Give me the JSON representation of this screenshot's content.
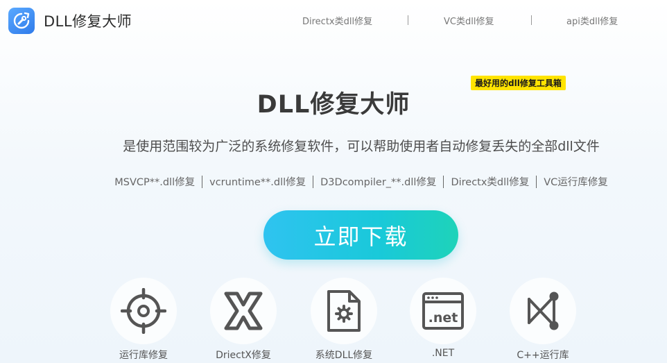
{
  "header": {
    "brand": "DLL修复大师",
    "nav": [
      {
        "label": "Directx类dll修复"
      },
      {
        "label": "VC类dll修复"
      },
      {
        "label": "api类dll修复"
      }
    ]
  },
  "hero": {
    "title": "DLL修复大师",
    "badge": "最好用的dll修复工具箱",
    "subtitle": "是使用范围较为广泛的系统修复软件，可以帮助使用者自动修复丢失的全部dll文件",
    "tags": [
      "MSVCP**.dll修复",
      "vcruntime**.dll修复",
      "D3Dcompiler_**.dll修复",
      "Directx类dll修复",
      "VC运行库修复"
    ],
    "download_label": "立即下载"
  },
  "features": [
    {
      "label": "运行库修复",
      "icon": "target-icon"
    },
    {
      "label": "DriectX修复",
      "icon": "directx-icon"
    },
    {
      "label": "系统DLL修复",
      "icon": "file-gear-icon"
    },
    {
      "label": ".NET",
      "icon": "dotnet-window-icon"
    },
    {
      "label": "C++运行库",
      "icon": "visual-studio-icon"
    }
  ],
  "colors": {
    "accent_start": "#2fc3f0",
    "accent_end": "#1ed3b9",
    "badge": "#ffe400",
    "logo": "#3b8ff2",
    "icon_gray": "#555555"
  }
}
